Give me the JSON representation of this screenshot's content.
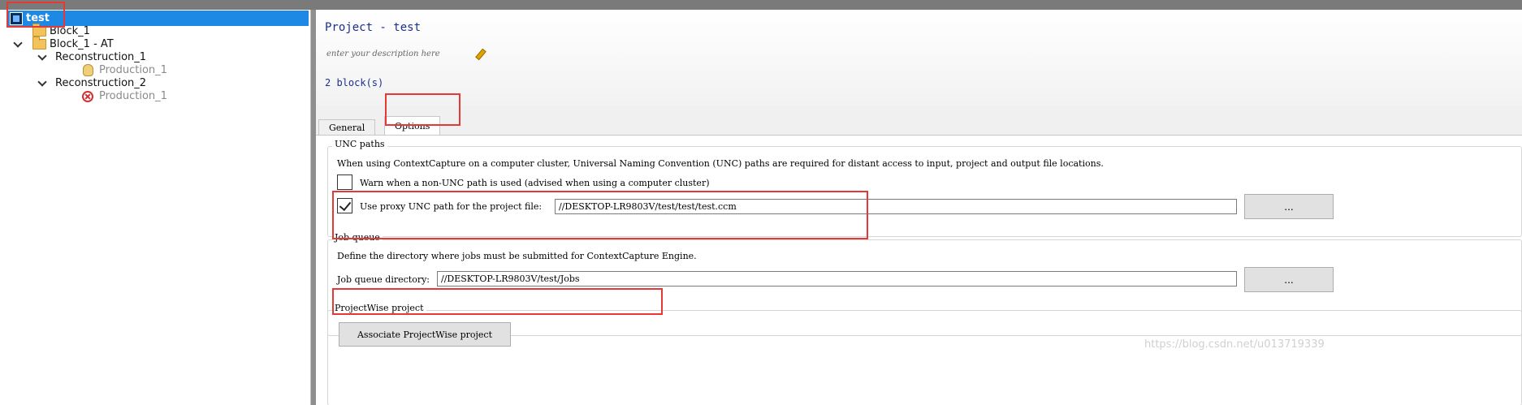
{
  "tree": {
    "items": [
      {
        "label": "test"
      },
      {
        "label": "Block_1"
      },
      {
        "label": "Block_1 - AT"
      },
      {
        "label": "Reconstruction_1"
      },
      {
        "label": "Production_1"
      },
      {
        "label": "Reconstruction_2"
      },
      {
        "label": "Production_1"
      }
    ]
  },
  "header": {
    "title": "Project - test",
    "description_placeholder": "enter your description here",
    "block_count": "2 block(s)"
  },
  "tabs": [
    {
      "label": "General"
    },
    {
      "label": "Options"
    }
  ],
  "unc": {
    "title": "UNC paths",
    "description": "When using ContextCapture on a computer cluster, Universal Naming Convention (UNC) paths are required for distant access to input, project and output file locations.",
    "warn_label": "Warn when a non-UNC path is used (advised when using a computer cluster)",
    "warn_checked": false,
    "proxy_label": "Use proxy UNC path for the project file:",
    "proxy_checked": true,
    "proxy_value": "//DESKTOP-LR9803V/test/test/test.ccm",
    "browse_label": "..."
  },
  "job_queue": {
    "title": "Job queue",
    "description": "Define the directory where jobs must be submitted for ContextCapture Engine.",
    "dir_label": "Job queue directory:",
    "dir_value": "//DESKTOP-LR9803V/test/Jobs",
    "browse_label": "..."
  },
  "projectwise": {
    "title": "ProjectWise project",
    "button_label": "Associate ProjectWise project"
  },
  "watermark": "https://blog.csdn.net/u013719339",
  "icons": [
    "project-icon",
    "folder-icon",
    "chevron-down-icon",
    "hand-icon",
    "error-icon",
    "pencil-icon"
  ],
  "colors": {
    "selection": "#1e88e5",
    "highlight_box": "#e53935",
    "title_text": "#1a2f8c"
  }
}
